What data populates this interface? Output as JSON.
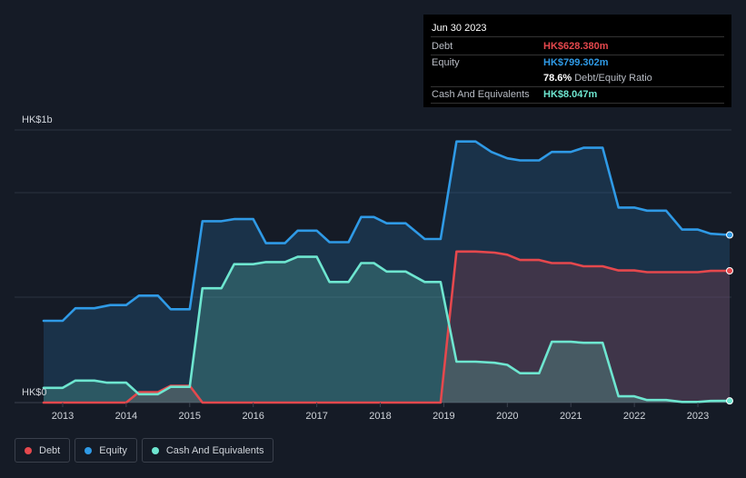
{
  "tooltip": {
    "date": "Jun 30 2023",
    "rows": [
      {
        "label": "Debt",
        "value": "HK$628.380m",
        "color": "#e5484d"
      },
      {
        "label": "Equity",
        "value": "HK$799.302m",
        "color": "#2f9ae6"
      },
      {
        "label": "",
        "value": "78.6%",
        "suffix": "Debt/Equity Ratio"
      },
      {
        "label": "Cash And Equivalents",
        "value": "HK$8.047m",
        "color": "#6ee6d0"
      }
    ]
  },
  "legend": [
    {
      "label": "Debt",
      "color": "#e5484d"
    },
    {
      "label": "Equity",
      "color": "#2f9ae6"
    },
    {
      "label": "Cash And Equivalents",
      "color": "#6ee6d0"
    }
  ],
  "chart_data": {
    "type": "area",
    "y_top_label": "HK$1b",
    "y_bottom_label": "HK$0",
    "ylim": [
      0,
      1300
    ],
    "xlim": [
      2012.7,
      2023.5
    ],
    "x_ticks": [
      "2013",
      "2014",
      "2015",
      "2016",
      "2017",
      "2018",
      "2019",
      "2020",
      "2021",
      "2022",
      "2023"
    ],
    "grid": true,
    "series": [
      {
        "name": "Equity",
        "color": "#2f9ae6",
        "points": [
          [
            2012.7,
            390
          ],
          [
            2013.0,
            390
          ],
          [
            2013.2,
            450
          ],
          [
            2013.5,
            450
          ],
          [
            2013.75,
            465
          ],
          [
            2014.0,
            465
          ],
          [
            2014.2,
            510
          ],
          [
            2014.5,
            510
          ],
          [
            2014.7,
            445
          ],
          [
            2015.0,
            445
          ],
          [
            2015.2,
            865
          ],
          [
            2015.5,
            865
          ],
          [
            2015.7,
            875
          ],
          [
            2016.0,
            875
          ],
          [
            2016.2,
            760
          ],
          [
            2016.5,
            760
          ],
          [
            2016.7,
            820
          ],
          [
            2017.0,
            820
          ],
          [
            2017.2,
            765
          ],
          [
            2017.5,
            765
          ],
          [
            2017.7,
            885
          ],
          [
            2017.9,
            885
          ],
          [
            2018.1,
            855
          ],
          [
            2018.4,
            855
          ],
          [
            2018.7,
            780
          ],
          [
            2018.95,
            780
          ],
          [
            2019.2,
            1245
          ],
          [
            2019.5,
            1245
          ],
          [
            2019.75,
            1195
          ],
          [
            2020.0,
            1165
          ],
          [
            2020.2,
            1155
          ],
          [
            2020.5,
            1155
          ],
          [
            2020.7,
            1195
          ],
          [
            2021.0,
            1195
          ],
          [
            2021.2,
            1215
          ],
          [
            2021.5,
            1215
          ],
          [
            2021.75,
            930
          ],
          [
            2022.0,
            930
          ],
          [
            2022.2,
            915
          ],
          [
            2022.5,
            915
          ],
          [
            2022.75,
            825
          ],
          [
            2023.0,
            825
          ],
          [
            2023.2,
            805
          ],
          [
            2023.5,
            799.302
          ]
        ]
      },
      {
        "name": "Debt",
        "color": "#e5484d",
        "points": [
          [
            2012.7,
            0
          ],
          [
            2014.0,
            0
          ],
          [
            2014.2,
            50
          ],
          [
            2014.5,
            50
          ],
          [
            2014.7,
            80
          ],
          [
            2015.0,
            80
          ],
          [
            2015.2,
            0
          ],
          [
            2018.95,
            0
          ],
          [
            2019.2,
            720
          ],
          [
            2019.5,
            720
          ],
          [
            2019.8,
            715
          ],
          [
            2020.0,
            705
          ],
          [
            2020.2,
            680
          ],
          [
            2020.5,
            680
          ],
          [
            2020.7,
            665
          ],
          [
            2021.0,
            665
          ],
          [
            2021.2,
            650
          ],
          [
            2021.5,
            650
          ],
          [
            2021.75,
            630
          ],
          [
            2022.0,
            630
          ],
          [
            2022.2,
            622
          ],
          [
            2022.5,
            622
          ],
          [
            2022.75,
            622
          ],
          [
            2023.0,
            622
          ],
          [
            2023.2,
            628
          ],
          [
            2023.5,
            628.38
          ]
        ]
      },
      {
        "name": "Cash And Equivalents",
        "color": "#6ee6d0",
        "points": [
          [
            2012.7,
            70
          ],
          [
            2013.0,
            70
          ],
          [
            2013.2,
            105
          ],
          [
            2013.5,
            105
          ],
          [
            2013.7,
            95
          ],
          [
            2014.0,
            95
          ],
          [
            2014.2,
            40
          ],
          [
            2014.5,
            40
          ],
          [
            2014.7,
            75
          ],
          [
            2015.0,
            75
          ],
          [
            2015.2,
            545
          ],
          [
            2015.5,
            545
          ],
          [
            2015.7,
            660
          ],
          [
            2016.0,
            660
          ],
          [
            2016.2,
            670
          ],
          [
            2016.5,
            670
          ],
          [
            2016.7,
            695
          ],
          [
            2017.0,
            695
          ],
          [
            2017.2,
            575
          ],
          [
            2017.5,
            575
          ],
          [
            2017.7,
            665
          ],
          [
            2017.9,
            665
          ],
          [
            2018.1,
            625
          ],
          [
            2018.4,
            625
          ],
          [
            2018.7,
            575
          ],
          [
            2018.95,
            575
          ],
          [
            2019.2,
            195
          ],
          [
            2019.5,
            195
          ],
          [
            2019.8,
            190
          ],
          [
            2020.0,
            180
          ],
          [
            2020.2,
            140
          ],
          [
            2020.5,
            140
          ],
          [
            2020.7,
            290
          ],
          [
            2021.0,
            290
          ],
          [
            2021.2,
            285
          ],
          [
            2021.5,
            285
          ],
          [
            2021.75,
            30
          ],
          [
            2022.0,
            30
          ],
          [
            2022.2,
            12
          ],
          [
            2022.5,
            12
          ],
          [
            2022.75,
            3
          ],
          [
            2023.0,
            3
          ],
          [
            2023.2,
            8
          ],
          [
            2023.5,
            8.047
          ]
        ]
      }
    ]
  }
}
